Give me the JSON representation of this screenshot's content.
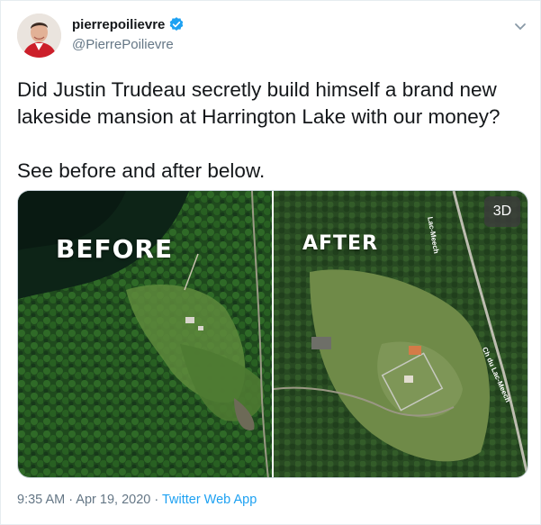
{
  "tweet": {
    "display_name": "pierrepoilievre",
    "handle": "@PierrePoilievre",
    "text": "Did Justin Trudeau secretly build himself a brand new lakeside mansion at Harrington Lake with our money?\n\nSee before and after below.",
    "timestamp": "9:35 AM · Apr 19, 2020 · ",
    "source": "Twitter Web App"
  },
  "media": {
    "before_label": "BEFORE",
    "after_label": "AFTER",
    "badge": "3D",
    "road_label_1": "Lac-Meech",
    "road_label_2": "Ch du Lac-Meech"
  },
  "colors": {
    "verified": "#1da1f2",
    "link": "#1da1f2",
    "secondary_text": "#657786"
  },
  "icons": {
    "verified": "verified-badge-icon",
    "menu": "chevron-down-icon"
  }
}
